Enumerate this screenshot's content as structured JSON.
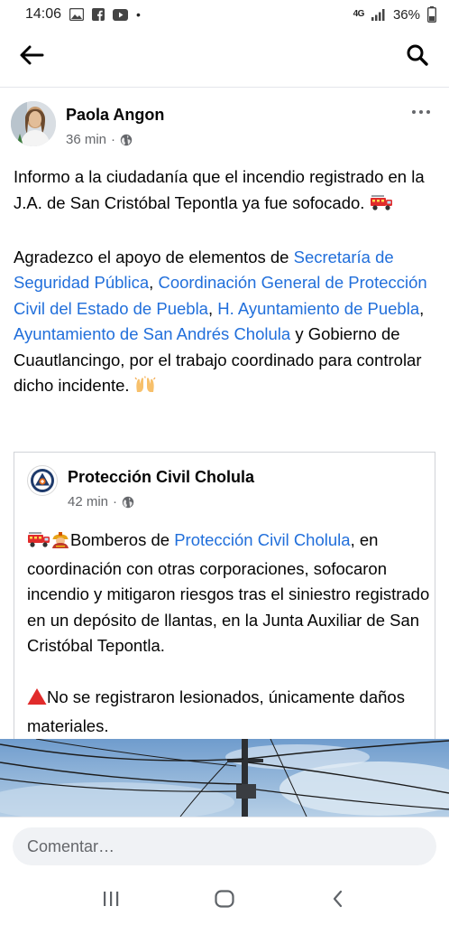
{
  "status_bar": {
    "time": "14:06",
    "battery": "36%",
    "dot": "•",
    "network": "4G"
  },
  "app_bar": {
    "back_icon": "arrow-left-icon",
    "search_icon": "search-icon"
  },
  "post": {
    "author": "Paola Angon",
    "time": "36 min",
    "separator": "·",
    "audience_icon": "globe-icon",
    "paragraph1": "Informo a la ciudadanía que el incendio registrado en la J.A. de San Cristóbal Tepontla ya fue sofocado.",
    "p2_intro": "Agradezco el apoyo de elementos de ",
    "p2_link1": "Secretaría de Seguridad Pública",
    "p2_sep1": ", ",
    "p2_link2": "Coordinación General de Protección Civil del Estado de Puebla",
    "p2_sep2": ", ",
    "p2_link3": "H. Ayuntamiento de Puebla",
    "p2_sep3": ", ",
    "p2_link4": "Ayuntamiento de San Andrés Cholula",
    "p2_outro": " y Gobierno de Cuautlancingo, por el trabajo coordinado para controlar dicho incidente."
  },
  "shared_post": {
    "author": "Protección Civil Cholula",
    "time": "42 min",
    "separator": "·",
    "line1_pre": "Bomberos de ",
    "line1_link": "Protección Civil Cholula",
    "line1_post": ", en coordinación con otras corporaciones, sofocaron incendio y mitigaron riesgos tras el siniestro registrado en un depósito de llantas, en la Junta Auxiliar de San Cristóbal Tepontla.",
    "line2": "No se registraron lesionados, únicamente daños materiales."
  },
  "comment": {
    "placeholder": "Comentar…"
  },
  "colors": {
    "link": "#216fdb",
    "meta": "#65676b",
    "input_bg": "#f0f2f5"
  }
}
